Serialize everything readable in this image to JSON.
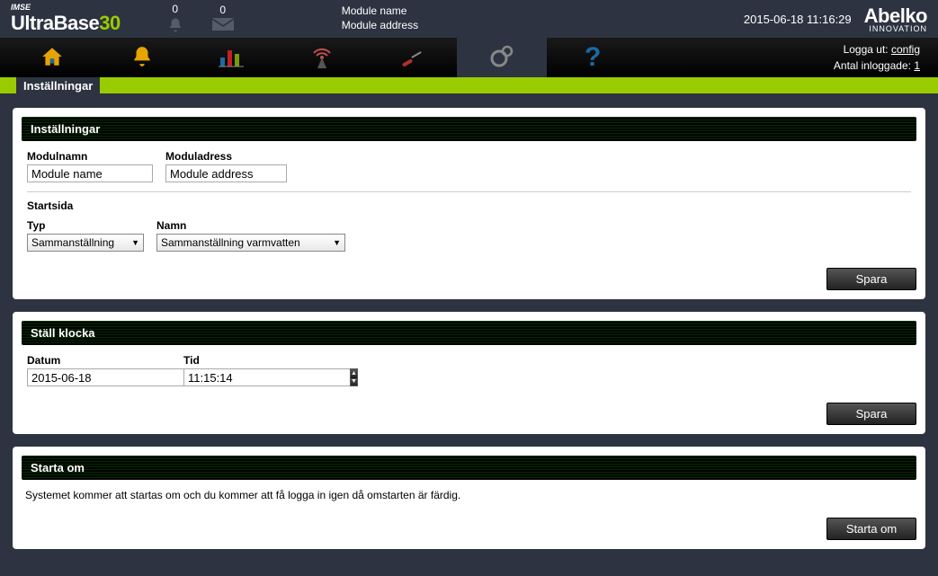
{
  "header": {
    "logo_imse": "IMSE",
    "logo_ultra": "UltraBase",
    "logo_30": "30",
    "counter_bell": "0",
    "counter_mail": "0",
    "module_name": "Module name",
    "module_address": "Module address",
    "datetime": "2015-06-18 11:16:29",
    "brand": "Abelko",
    "brand_sub": "INNOVATION"
  },
  "userbox": {
    "logout_label": "Logga ut:",
    "logout_user": "config",
    "logged_in_label": "Antal inloggade:",
    "logged_in_count": "1"
  },
  "page_title": "Inställningar",
  "panel1": {
    "title": "Inställningar",
    "label_modulname": "Modulnamn",
    "value_modulname": "Module name",
    "label_moduladress": "Moduladress",
    "value_moduladress": "Module address",
    "label_startsida": "Startsida",
    "label_typ": "Typ",
    "value_typ": "Sammanställning",
    "label_namn": "Namn",
    "value_namn": "Sammanställning varmvatten",
    "save": "Spara"
  },
  "panel2": {
    "title": "Ställ klocka",
    "label_datum": "Datum",
    "value_datum": "2015-06-18",
    "label_tid": "Tid",
    "value_tid": "11:15:14",
    "save": "Spara"
  },
  "panel3": {
    "title": "Starta om",
    "text": "Systemet kommer att startas om och du kommer att få logga in igen då omstarten är färdig.",
    "button": "Starta om"
  }
}
